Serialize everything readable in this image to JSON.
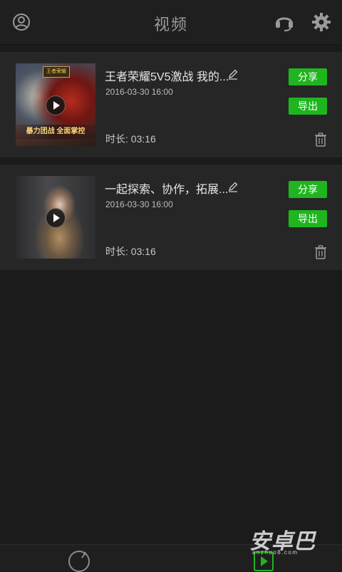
{
  "header": {
    "title": "视频",
    "icons": [
      "user-icon",
      "headset-icon",
      "gear-icon"
    ]
  },
  "videos": [
    {
      "title": "王者荣耀5V5激战 我的...",
      "date": "2016-03-30  16:00",
      "duration": "时长: 03:16",
      "thumb_logo": "王者荣耀",
      "thumb_caption": "暴力团战 全面掌控",
      "share_label": "分享",
      "export_label": "导出"
    },
    {
      "title": "一起探索、协作，拓展...",
      "date": "2016-03-30  16:00",
      "duration": "时长: 03:16",
      "share_label": "分享",
      "export_label": "导出"
    }
  ],
  "bottom_nav": {
    "tabs": [
      "record-tab-icon",
      "video-tab-icon"
    ],
    "active": "video-tab-icon"
  },
  "watermark": {
    "text": "安卓巴",
    "url": "anzhuo8.com"
  },
  "colors": {
    "background": "#1b1b1b",
    "card": "#262626",
    "accent_green": "#1fb51f",
    "title_gray": "#9a9a9a"
  }
}
